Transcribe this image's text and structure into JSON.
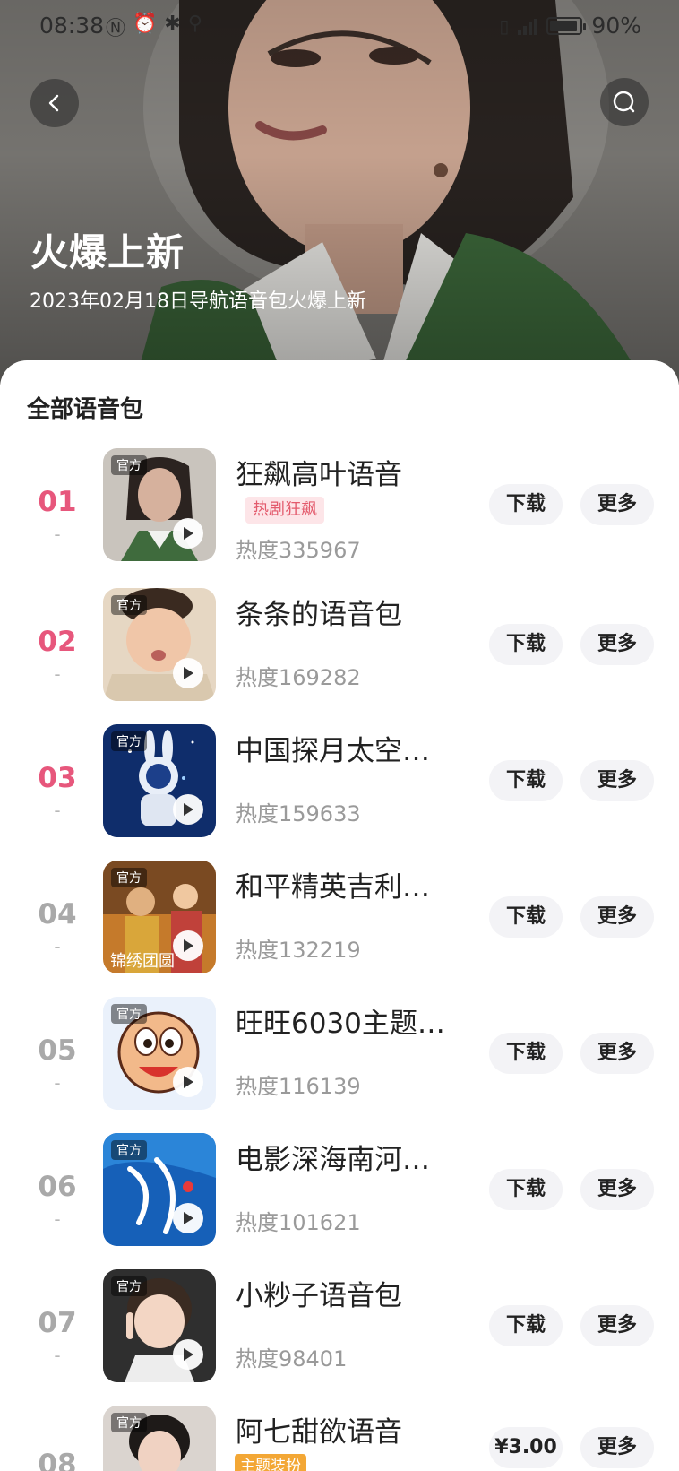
{
  "status": {
    "time": "08:38",
    "battery": "90%"
  },
  "hero": {
    "title": "火爆上新",
    "subtitle": "2023年02月18日导航语音包火爆上新"
  },
  "section": {
    "title": "全部语音包"
  },
  "labels": {
    "official": "官方",
    "download": "下载",
    "more": "更多"
  },
  "items": [
    {
      "rank": "01",
      "dash": "-",
      "name": "狂飙高叶语音",
      "badge": "热剧狂飙",
      "heat": "热度335967",
      "official": true
    },
    {
      "rank": "02",
      "dash": "-",
      "name": "条条的语音包",
      "heat": "热度169282",
      "official": true
    },
    {
      "rank": "03",
      "dash": "-",
      "name": "中国探月太空…",
      "heat": "热度159633",
      "official": true
    },
    {
      "rank": "04",
      "dash": "-",
      "name": "和平精英吉利…",
      "heat": "热度132219",
      "official": true
    },
    {
      "rank": "05",
      "dash": "-",
      "name": "旺旺6030主题…",
      "heat": "热度116139",
      "official": true
    },
    {
      "rank": "06",
      "dash": "-",
      "name": "电影深海南河…",
      "heat": "热度101621",
      "official": true
    },
    {
      "rank": "07",
      "dash": "-",
      "name": "小粆子语音包",
      "heat": "热度98401",
      "official": true
    },
    {
      "rank": "08",
      "dash": "-",
      "name": "阿七甜欲语音",
      "badge": "主题装扮",
      "price": "¥3.00",
      "official": true
    }
  ],
  "thumb_icons": [
    "woman-portrait",
    "child-portrait",
    "astronaut-rabbit",
    "game-characters",
    "wangwang-mascot",
    "deep-sea-poster",
    "girl-portrait",
    "woman-portrait"
  ]
}
